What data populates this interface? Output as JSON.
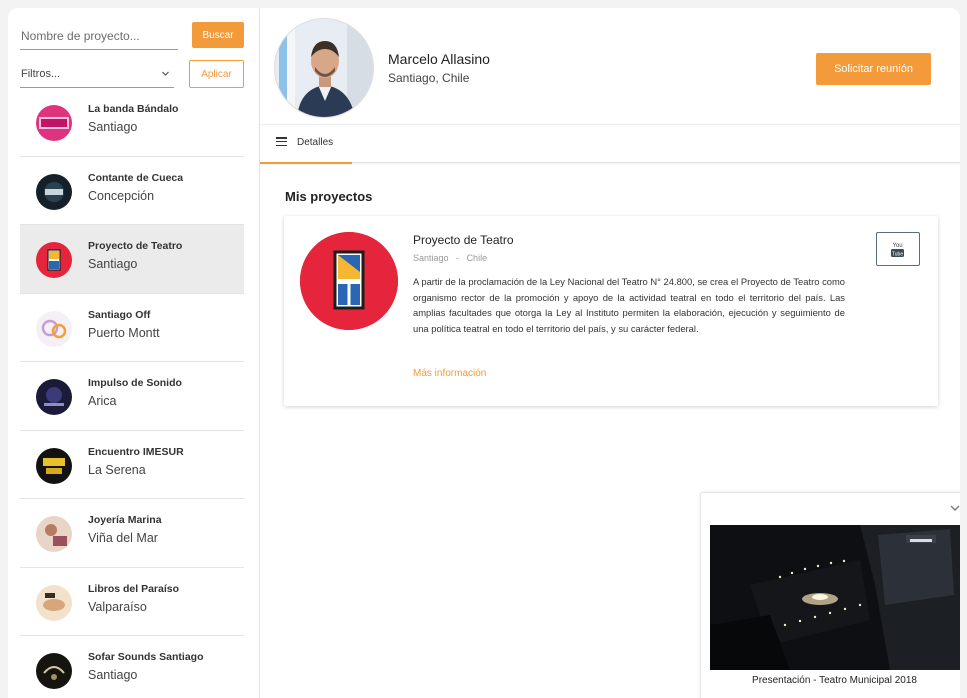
{
  "sidebar": {
    "search_placeholder": "Nombre de proyecto...",
    "search_button": "Buscar",
    "filter_label": "Filtros...",
    "apply_button": "Aplicar",
    "items": [
      {
        "name": "La banda Bándalo",
        "city": "Santiago"
      },
      {
        "name": "Contante de Cueca",
        "city": "Concepción"
      },
      {
        "name": "Proyecto de Teatro",
        "city": "Santiago"
      },
      {
        "name": "Santiago Off",
        "city": "Puerto Montt"
      },
      {
        "name": "Impulso de Sonido",
        "city": "Arica"
      },
      {
        "name": "Encuentro IMESUR",
        "city": "La Serena"
      },
      {
        "name": "Joyería Marina",
        "city": "Viña del Mar"
      },
      {
        "name": "Libros del Paraíso",
        "city": "Valparaíso"
      },
      {
        "name": "Sofar Sounds Santiago",
        "city": "Santiago"
      }
    ],
    "active_index": 2
  },
  "header": {
    "name": "Marcelo Allasino",
    "location": "Santiago, Chile",
    "meeting_button": "Solicitar reunión",
    "tab_label": "Detalles"
  },
  "main": {
    "section_title": "Mis proyectos",
    "project": {
      "title": "Proyecto de Teatro",
      "city": "Santiago",
      "separator": "-",
      "country": "Chile",
      "description": "A partir de la proclamación de la Ley Nacional del Teatro N° 24.800, se crea el Proyecto de Teatro como organismo rector de la promoción y apoyo de la actividad teatral en todo el territorio del país. Las amplias facultades que otorga la Ley al Instituto permiten la elaboración, ejecución y seguimiento de una política teatral en todo el territorio del país, y su carácter federal.",
      "more_link": "Más información",
      "video_icon_text": "You Tube"
    }
  },
  "video": {
    "caption": "Presentación - Teatro Municipal 2018"
  },
  "colors": {
    "accent": "#f39a3a",
    "project_red": "#e4253b",
    "active_row": "#ebebeb"
  }
}
